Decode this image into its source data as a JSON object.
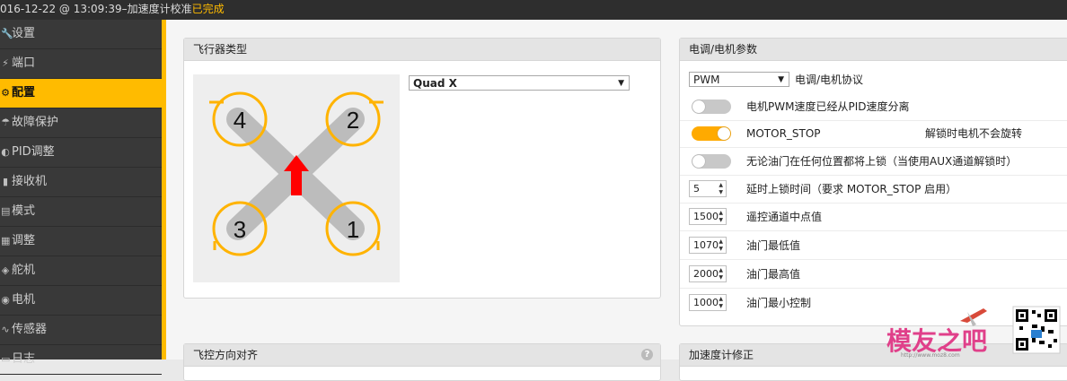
{
  "status_bar": {
    "timestamp": "016-12-22 @ 13:09:39",
    "separator": " – ",
    "message": "加速度计校准",
    "status": "已完成"
  },
  "sidebar": {
    "items": [
      {
        "label": "设置",
        "icon": "wrench-icon",
        "glyph": "🔧"
      },
      {
        "label": "端口",
        "icon": "plug-icon",
        "glyph": "⚡"
      },
      {
        "label": "配置",
        "icon": "gear-icon",
        "glyph": "⚙"
      },
      {
        "label": "故障保护",
        "icon": "parachute-icon",
        "glyph": "☂"
      },
      {
        "label": "PID调整",
        "icon": "pid-icon",
        "glyph": "◐"
      },
      {
        "label": "接收机",
        "icon": "receiver-icon",
        "glyph": "▮"
      },
      {
        "label": "模式",
        "icon": "modes-icon",
        "glyph": "▤"
      },
      {
        "label": "调整",
        "icon": "adjustments-icon",
        "glyph": "▦"
      },
      {
        "label": "舵机",
        "icon": "servo-icon",
        "glyph": "◈"
      },
      {
        "label": "电机",
        "icon": "motor-icon",
        "glyph": "◉"
      },
      {
        "label": "传感器",
        "icon": "sensor-icon",
        "glyph": "∿"
      },
      {
        "label": "日志",
        "icon": "log-icon",
        "glyph": "▭"
      }
    ],
    "active_index": 2
  },
  "mixer_panel": {
    "title": "飞行器类型",
    "selected_type": "Quad X",
    "motors": [
      "1",
      "2",
      "3",
      "4"
    ]
  },
  "esc_panel": {
    "title": "电调/电机参数",
    "protocol_value": "PWM",
    "protocol_label": "电调/电机协议",
    "pwm_sep_label": "电机PWM速度已经从PID速度分离",
    "motor_stop_label": "MOTOR_STOP",
    "motor_stop_note": "解锁时电机不会旋转",
    "arm_any_throttle_label": "无论油门在任何位置都将上锁（当使用AUX通道解锁时）",
    "disarm_delay_value": "5",
    "disarm_delay_label": "延时上锁时间（要求 MOTOR_STOP 启用）",
    "midrc_value": "1500",
    "midrc_label": "遥控通道中点值",
    "minthrottle_value": "1070",
    "minthrottle_label": "油门最低值",
    "maxthrottle_value": "2000",
    "maxthrottle_label": "油门最高值",
    "mincommand_value": "1000",
    "mincommand_label": "油门最小控制"
  },
  "board_align_panel": {
    "title": "飞控方向对齐"
  },
  "acc_trim_panel": {
    "title": "加速度计修正"
  },
  "watermark": {
    "brand": "模友之吧",
    "url": "http://www.moz8.com"
  },
  "colors": {
    "accent": "#ffbb00",
    "sidebar_bg": "#393939",
    "toggle_on": "#ffaa00",
    "arrow_red": "#ff0000",
    "watermark_pink": "#e0408a"
  }
}
